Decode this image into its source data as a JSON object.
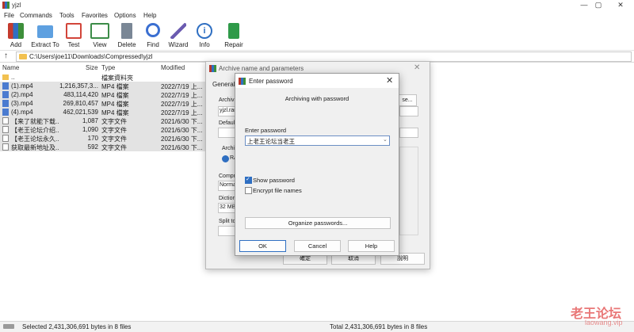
{
  "window": {
    "title": "yjzl",
    "min": "—",
    "max": "▢",
    "close": "✕"
  },
  "menu": [
    "File",
    "Commands",
    "Tools",
    "Favorites",
    "Options",
    "Help"
  ],
  "toolbar": [
    {
      "label": "Add",
      "icon": "add-icon",
      "color": "#c43b2e"
    },
    {
      "label": "Extract To",
      "icon": "extract-folder-icon",
      "color": "#5ea0e0"
    },
    {
      "label": "Test",
      "icon": "test-icon",
      "color": "#d2453a"
    },
    {
      "label": "View",
      "icon": "view-book-icon",
      "color": "#3c8c48"
    },
    {
      "label": "Delete",
      "icon": "trash-icon",
      "color": "#7a8796"
    },
    {
      "label": "Find",
      "icon": "magnifier-icon",
      "color": "#3b6fd1"
    },
    {
      "label": "Wizard",
      "icon": "wand-icon",
      "color": "#6b5bb0"
    },
    {
      "label": "Info",
      "icon": "info-icon",
      "color": "#2f6fc2"
    },
    {
      "label": "Repair",
      "icon": "repair-icon",
      "color": "#2f9a49"
    }
  ],
  "address": {
    "up": "↑",
    "path": "C:\\Users\\joe11\\Downloads\\Compressed\\yjzl"
  },
  "columns": {
    "name": "Name",
    "size": "Size",
    "type": "Type",
    "modified": "Modified"
  },
  "files": [
    {
      "name": "..",
      "size": "",
      "type": "檔案資料夾",
      "modified": "",
      "kind": "folder"
    },
    {
      "name": "(1).mp4",
      "size": "1,216,357,3...",
      "type": "MP4 檔案",
      "modified": "2022/7/19 上...",
      "kind": "mp4"
    },
    {
      "name": "(2).mp4",
      "size": "483,114,420",
      "type": "MP4 檔案",
      "modified": "2022/7/19 上...",
      "kind": "mp4"
    },
    {
      "name": "(3).mp4",
      "size": "269,810,457",
      "type": "MP4 檔案",
      "modified": "2022/7/19 上...",
      "kind": "mp4"
    },
    {
      "name": "(4).mp4",
      "size": "462,021,539",
      "type": "MP4 檔案",
      "modified": "2022/7/19 上...",
      "kind": "mp4"
    },
    {
      "name": "【来了就能下载...",
      "size": "1,087",
      "type": "文字文件",
      "modified": "2021/6/30 下...",
      "kind": "txt"
    },
    {
      "name": "【老王论坛介绍...",
      "size": "1,090",
      "type": "文字文件",
      "modified": "2021/6/30 下...",
      "kind": "txt"
    },
    {
      "name": "【老王论坛永久...",
      "size": "170",
      "type": "文字文件",
      "modified": "2021/6/30 下...",
      "kind": "txt"
    },
    {
      "name": "获取最新地址及...",
      "size": "592",
      "type": "文字文件",
      "modified": "2021/6/30 下...",
      "kind": "txt"
    }
  ],
  "status": {
    "left": "Selected 2,431,306,691 bytes in 8 files",
    "right": "Total 2,431,306,691 bytes in 8 files"
  },
  "archive_dialog": {
    "title": "Archive name and parameters",
    "close": "✕",
    "tab_general": "General",
    "archive_label": "Archiv",
    "archive_value": "yjzl.rar",
    "browse": "se...",
    "default_label": "Default",
    "format_label": "Archiv",
    "format_rar": "RA",
    "compression_label": "Compre",
    "compression_value": "Norma",
    "dictionary_label": "Diction",
    "dictionary_value": "32 MB",
    "split_label": "Split to",
    "ok": "確定",
    "cancel": "取消",
    "help": "說明"
  },
  "password_dialog": {
    "title": "Enter password",
    "close": "✕",
    "heading": "Archiving with password",
    "label": "Enter password",
    "value": "上老王论坛当老王",
    "dropdown": "⌄",
    "show_password": "Show password",
    "encrypt_names": "Encrypt file names",
    "organize": "Organize passwords...",
    "ok": "OK",
    "cancel": "Cancel",
    "help": "Help"
  },
  "watermark": {
    "text": "老王论坛",
    "url": "laowang.vip"
  }
}
